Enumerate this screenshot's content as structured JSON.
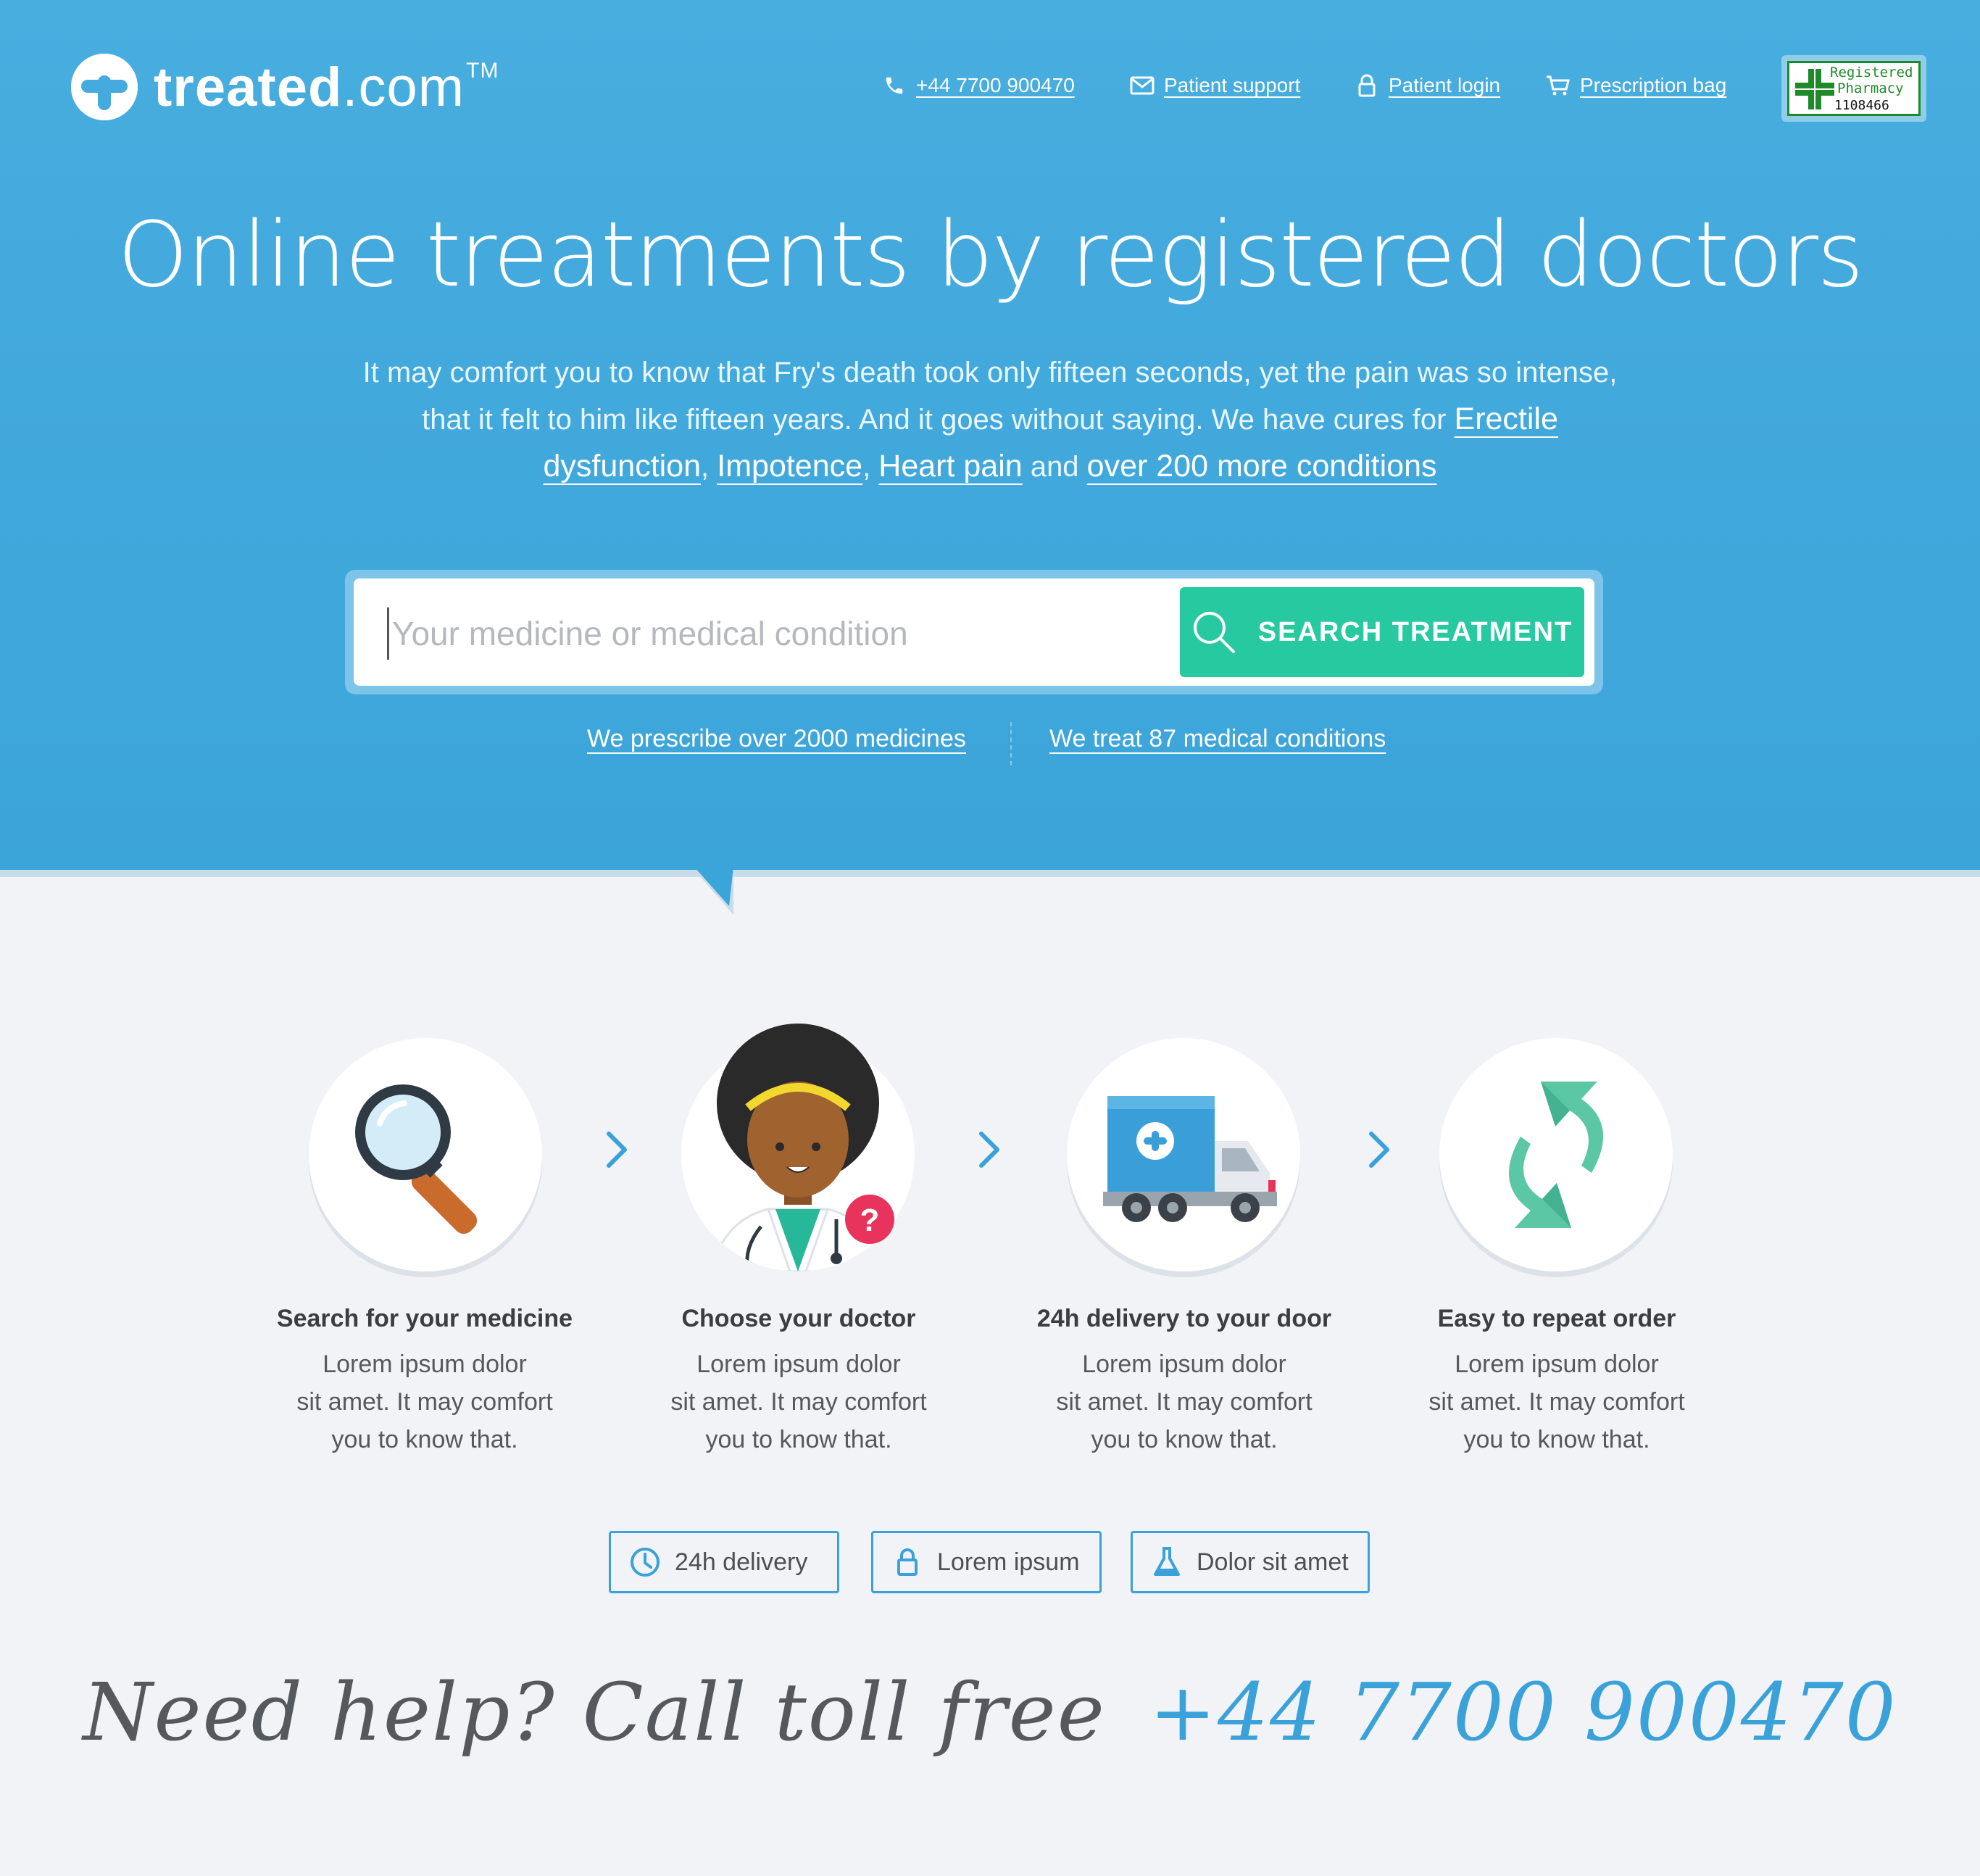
{
  "header": {
    "logo": {
      "name": "treated",
      "suffix": ".com",
      "tm": "TM"
    },
    "nav": [
      {
        "label": "+44 7700 900470",
        "icon": "phone-icon"
      },
      {
        "label": "Patient support",
        "icon": "mail-icon"
      },
      {
        "label": "Patient login",
        "icon": "lock-icon"
      },
      {
        "label": "Prescription bag",
        "icon": "cart-icon"
      }
    ],
    "badge": {
      "line1": "Registered",
      "line2": "Pharmacy",
      "number": "1108466"
    }
  },
  "hero": {
    "headline": "Online treatments by registered doctors",
    "intro_text": "It may comfort you to know that Fry's death took only fifteen seconds, yet the pain was so intense, that it felt to him like fifteen years. And it goes without saying. We have cures for ",
    "conditions": [
      "Erectile dysfunction",
      "Impotence",
      "Heart pain"
    ],
    "sep1": ", ",
    "sep2": ", ",
    "and_text": " and ",
    "more_link": "over 200 more conditions",
    "search": {
      "placeholder": "Your medicine or medical condition",
      "button": "SEARCH TREATMENT"
    },
    "sublinks": [
      "We prescribe over 2000 medicines",
      "We treat 87 medical conditions"
    ]
  },
  "steps": [
    {
      "title": "Search for your medicine",
      "desc_lines": [
        "Lorem ipsum dolor",
        "sit amet. It may comfort",
        "you to know that."
      ],
      "icon": "magnifier-icon"
    },
    {
      "title": "Choose your doctor",
      "desc_lines": [
        "Lorem ipsum dolor",
        "sit amet. It may comfort",
        "you to know that."
      ],
      "icon": "doctor-icon"
    },
    {
      "title": "24h delivery to your door",
      "desc_lines": [
        "Lorem ipsum dolor",
        "sit amet. It may comfort",
        "you to know that."
      ],
      "icon": "truck-icon"
    },
    {
      "title": "Easy to repeat order",
      "desc_lines": [
        "Lorem ipsum dolor",
        "sit amet. It may comfort",
        "you to know that."
      ],
      "icon": "repeat-icon"
    }
  ],
  "badges": [
    {
      "label": "24h delivery",
      "icon": "clock-icon"
    },
    {
      "label": "Lorem ipsum",
      "icon": "lock-icon"
    },
    {
      "label": "Dolor sit amet",
      "icon": "flask-icon"
    }
  ],
  "help": {
    "text": "Need help? Call toll free",
    "phone": "+44 7700 900470"
  },
  "colors": {
    "hero_blue": "#3ba4d9",
    "accent_green": "#27c9a0",
    "accent_blue": "#3aa2d8",
    "background": "#f1f3f7"
  }
}
